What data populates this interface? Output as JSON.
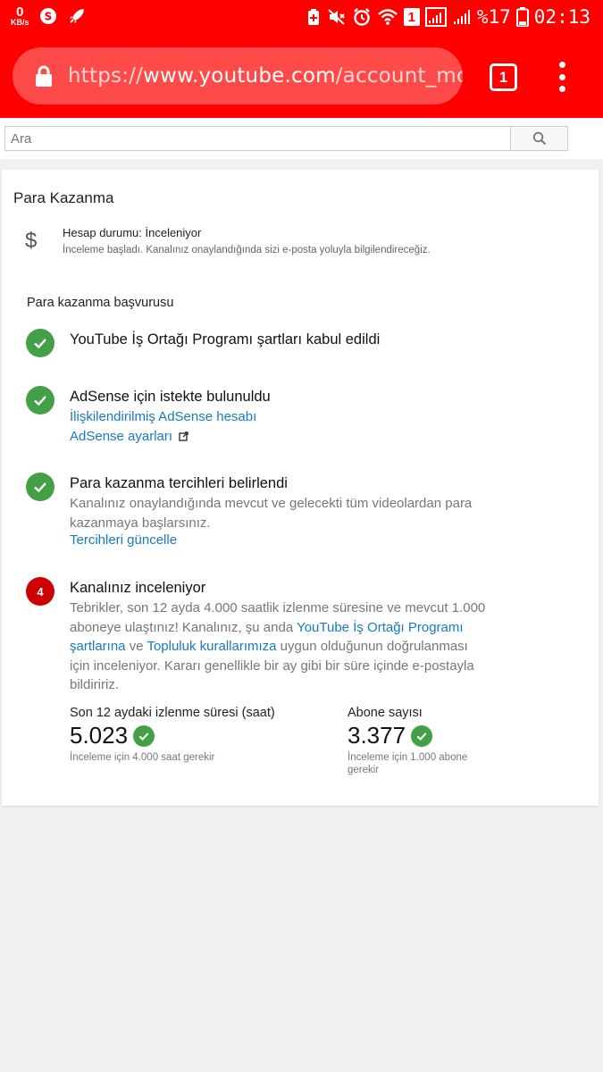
{
  "status_bar": {
    "data_speed": "0",
    "data_speed_unit": "KB/s",
    "battery": "%17",
    "time": "02:13",
    "sim_indicator": "1"
  },
  "browser": {
    "url_prefix": "https://",
    "url_domain": "www.youtube.com",
    "url_path": "/account_monet",
    "tab_count": "1"
  },
  "search": {
    "placeholder": "Ara"
  },
  "monetization": {
    "title": "Para Kazanma",
    "account_status": "Hesap durumu: İnceleniyor",
    "account_status_desc": "İnceleme başladı. Kanalınız onaylandığında sizi e-posta yoluyla bilgilendireceğiz.",
    "section_title": "Para kazanma başvurusu",
    "steps": [
      {
        "title": "YouTube İş Ortağı Programı şartları kabul edildi"
      },
      {
        "title": "AdSense için istekte bulunuldu",
        "link1": "İlişkilendirilmiş AdSense hesabı",
        "link2": "AdSense ayarları"
      },
      {
        "title": "Para kazanma tercihleri belirlendi",
        "desc": "Kanalınız onaylandığında mevcut ve gelecekti tüm videolardan para kazanmaya başlarsınız.",
        "link": "Tercihleri güncelle"
      },
      {
        "number": "4",
        "title": "Kanalınız inceleniyor",
        "desc_part1": "Tebrikler, son 12 ayda 4.000 saatlik izlenme süresine ve mevcut 1.000 aboneye ulaştınız! Kanalınız, şu anda ",
        "desc_link1": "YouTube İş Ortağı Programı şartlarına",
        "desc_part2": " ve ",
        "desc_link2": "Topluluk kurallarımıza",
        "desc_part3": " uygun olduğunun doğrulanması için inceleniyor. Kararı genellikle bir ay gibi bir süre içinde e-postayla bildiririz."
      }
    ],
    "metrics": [
      {
        "label": "Son 12 aydaki izlenme süresi (saat)",
        "value": "5.023",
        "hint": "İnceleme için 4.000 saat gerekir"
      },
      {
        "label": "Abone sayısı",
        "value": "3.377",
        "hint": "İnceleme için 1.000 abone gerekir"
      }
    ]
  },
  "colors": {
    "brand_red": "#ff0000",
    "success_green": "#43a047",
    "link_blue": "#167ac6",
    "step_red": "#cc0000"
  }
}
